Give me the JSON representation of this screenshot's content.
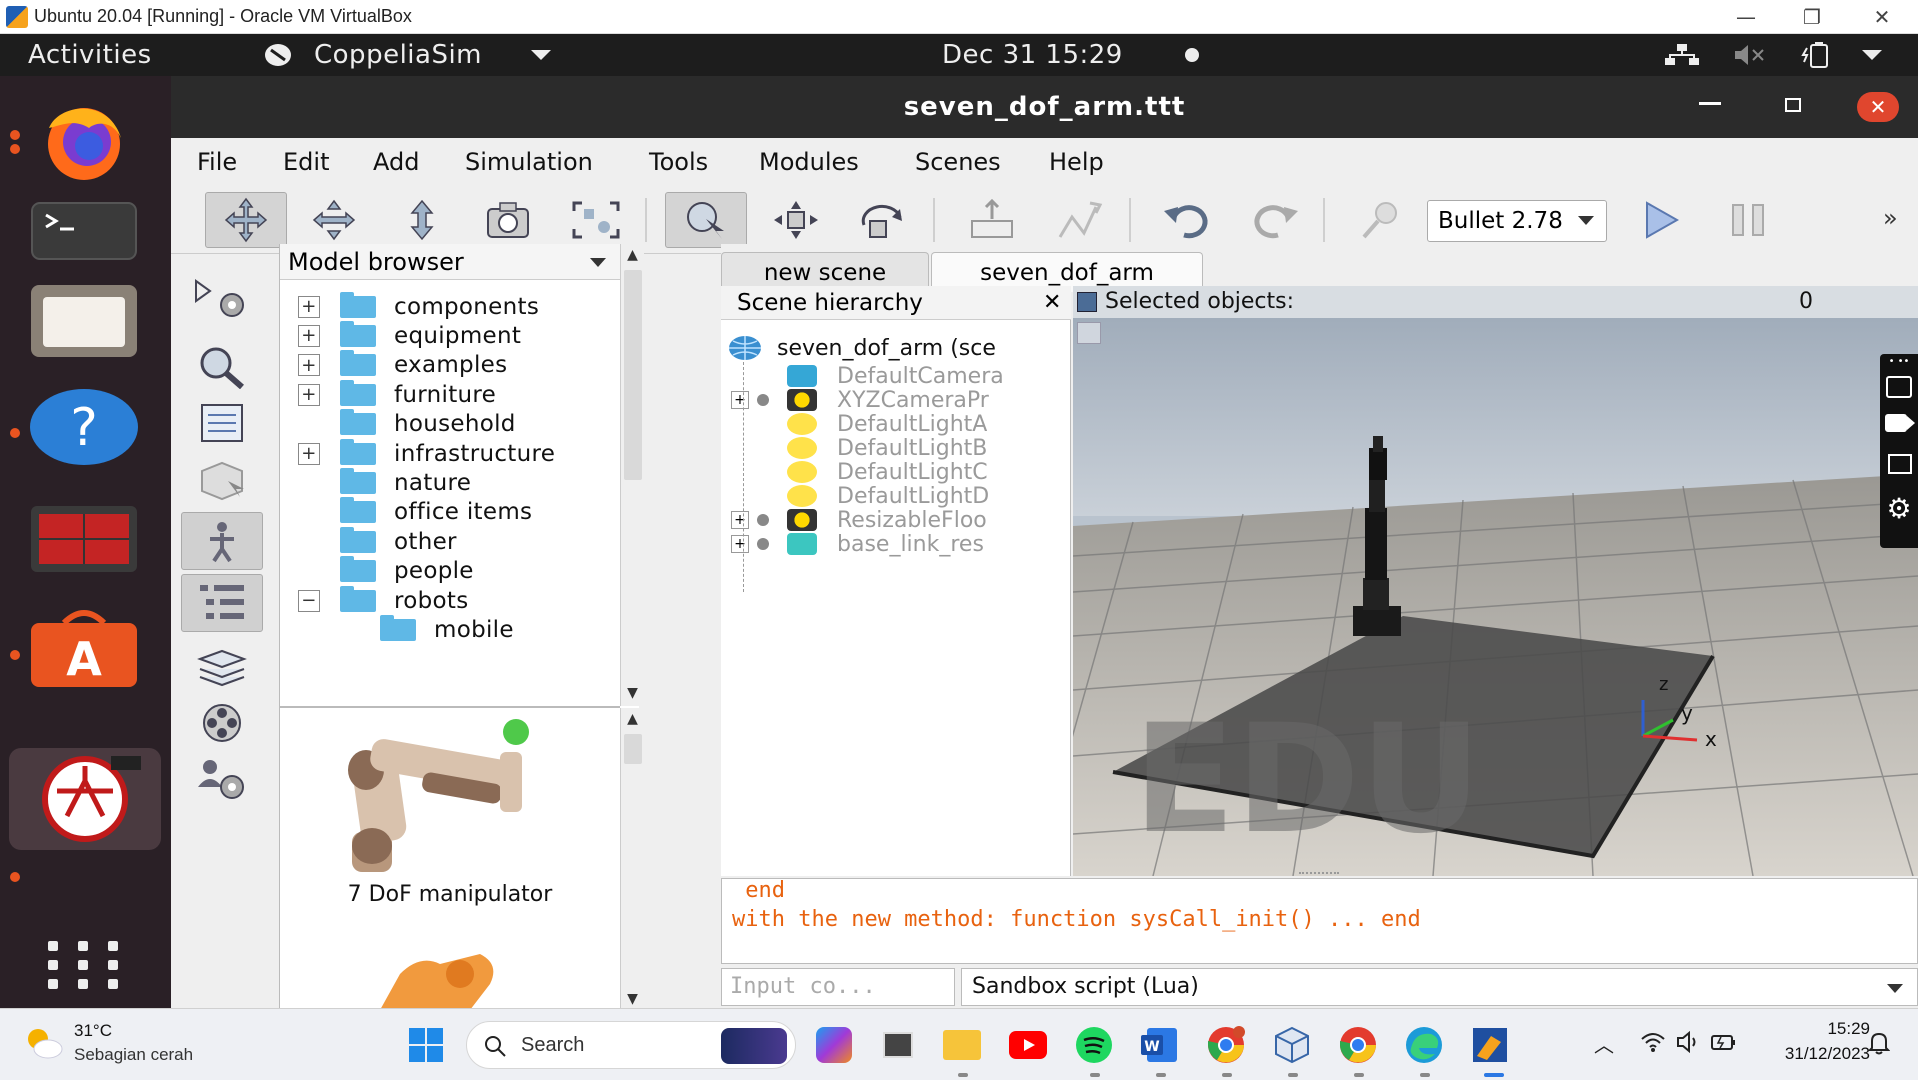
{
  "host": {
    "title": "Ubuntu 20.04 [Running] - Oracle VM VirtualBox",
    "controls": {
      "minimize": "—",
      "restore": "❐",
      "close": "✕"
    }
  },
  "topbar": {
    "activities": "Activities",
    "app_name": "CoppeliaSim",
    "clock": "Dec 31  15:29"
  },
  "dock": {
    "items": [
      "firefox",
      "terminal",
      "files",
      "help",
      "system-monitor",
      "software",
      "coppeliasim",
      "show-apps"
    ]
  },
  "window": {
    "title": "seven_dof_arm.ttt",
    "menu": [
      "File",
      "Edit",
      "Add",
      "Simulation",
      "Tools",
      "Modules",
      "Scenes",
      "Help"
    ],
    "engine": "Bullet 2.78"
  },
  "model_browser": {
    "header": "Model browser",
    "folders": [
      {
        "label": "components",
        "expander": "+"
      },
      {
        "label": "equipment",
        "expander": "+"
      },
      {
        "label": "examples",
        "expander": "+"
      },
      {
        "label": "furniture",
        "expander": "+"
      },
      {
        "label": "household",
        "expander": ""
      },
      {
        "label": "infrastructure",
        "expander": "+"
      },
      {
        "label": "nature",
        "expander": ""
      },
      {
        "label": "office items",
        "expander": ""
      },
      {
        "label": "other",
        "expander": ""
      },
      {
        "label": "people",
        "expander": ""
      },
      {
        "label": "robots",
        "expander": "−"
      },
      {
        "label": "mobile",
        "expander": ""
      }
    ],
    "thumb_caption": "7 DoF manipulator"
  },
  "tabs": [
    "new scene",
    "seven_dof_arm"
  ],
  "hierarchy": {
    "header": "Scene hierarchy",
    "root": "seven_dof_arm (sce",
    "items": [
      {
        "label": "DefaultCamera",
        "expander": ""
      },
      {
        "label": "XYZCameraPr",
        "expander": "+"
      },
      {
        "label": "DefaultLightA",
        "expander": ""
      },
      {
        "label": "DefaultLightB",
        "expander": ""
      },
      {
        "label": "DefaultLightC",
        "expander": ""
      },
      {
        "label": "DefaultLightD",
        "expander": ""
      },
      {
        "label": "ResizableFloo",
        "expander": "+"
      },
      {
        "label": "base_link_res",
        "expander": "+"
      }
    ]
  },
  "viewport": {
    "selected_label": "Selected objects:",
    "selected_count": "0",
    "watermark": "EDU",
    "axes": {
      "z": "z",
      "y": "y",
      "x": "x"
    }
  },
  "console": {
    "line1": " end",
    "line2": "with the new method: function sysCall_init() ... end"
  },
  "command": {
    "input_placeholder": "Input  co...",
    "script_mode": "Sandbox script (Lua)"
  },
  "taskbar": {
    "weather_temp": "31°C",
    "weather_desc": "Sebagian cerah",
    "search_label": "Search",
    "time": "15:29",
    "date": "31/12/2023"
  },
  "colors": {
    "ubuntu_orange": "#e95420",
    "folder_blue": "#5fb8e6",
    "console_orange": "#e8620f",
    "close_red": "#e0462e"
  }
}
